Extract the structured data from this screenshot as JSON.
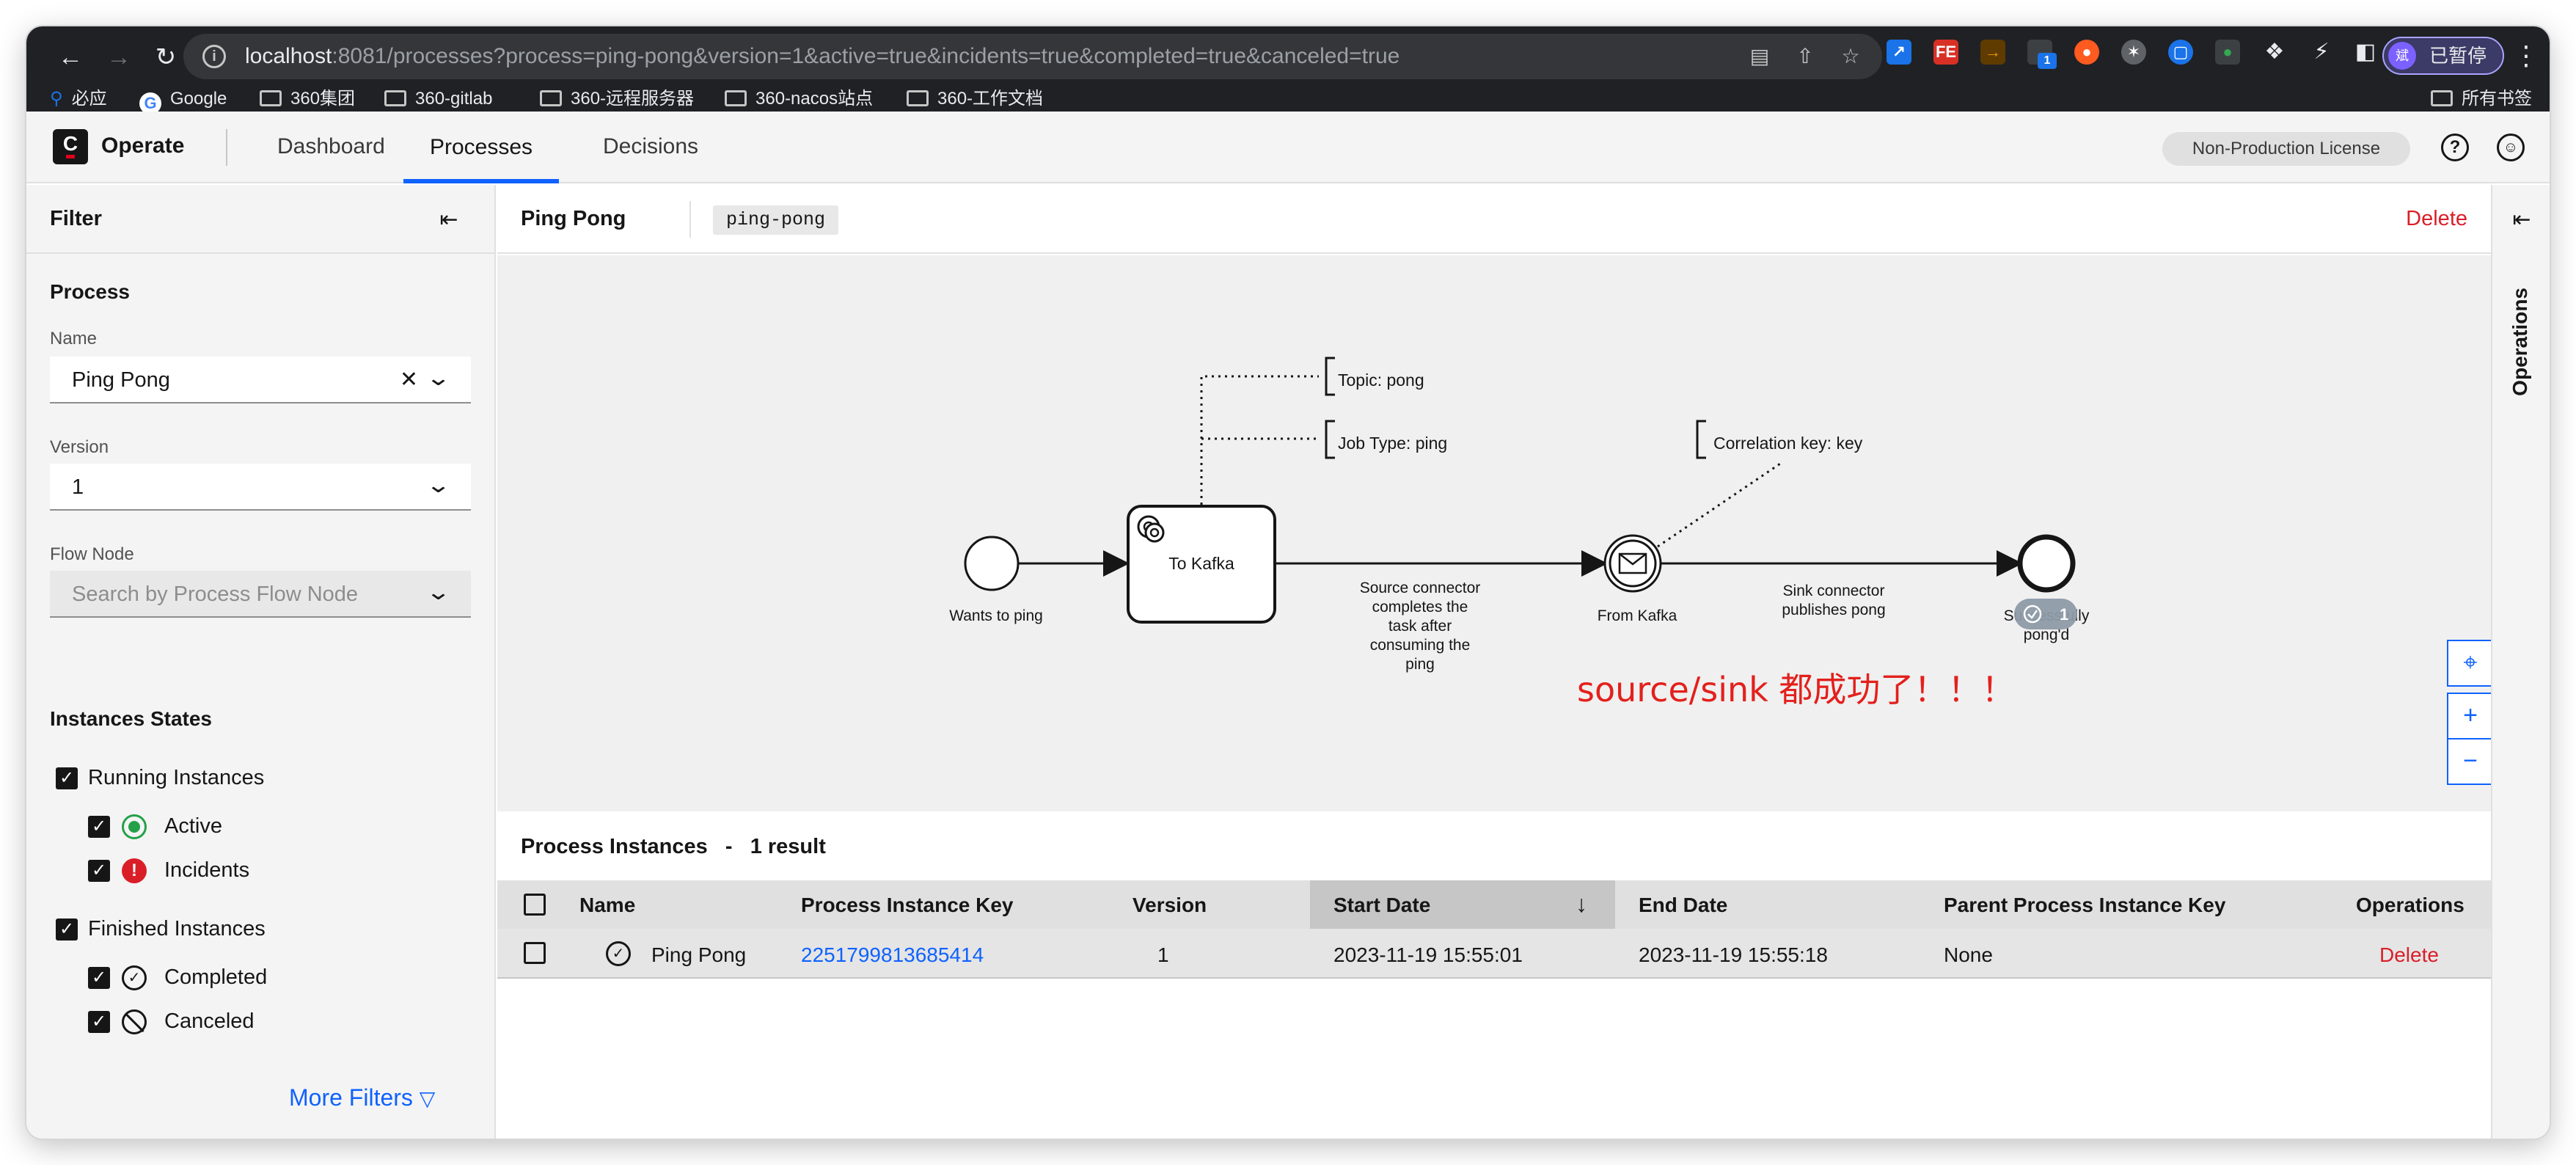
{
  "browser": {
    "url_host": "localhost",
    "url_rest": ":8081/processes?process=ping-pong&version=1&active=true&incidents=true&completed=true&canceled=true",
    "profile_label": "已暂停",
    "profile_initial": "斌",
    "ext_badge": "1",
    "bookmarks": [
      "必应",
      "Google",
      "360集团",
      "360-gitlab",
      "360-远程服务器",
      "360-nacos站点",
      "360-工作文档"
    ],
    "all_bookmarks": "所有书签"
  },
  "header": {
    "brand": "Operate",
    "logo": "C",
    "tabs": [
      "Dashboard",
      "Processes",
      "Decisions"
    ],
    "license": "Non-Production License"
  },
  "filters": {
    "title": "Filter",
    "process_section": "Process",
    "name_label": "Name",
    "name_value": "Ping Pong",
    "version_label": "Version",
    "version_value": "1",
    "flow_node_label": "Flow Node",
    "flow_node_placeholder": "Search by Process Flow Node",
    "states_section": "Instances States",
    "running": "Running Instances",
    "active": "Active",
    "incidents": "Incidents",
    "finished": "Finished Instances",
    "completed": "Completed",
    "canceled": "Canceled",
    "more_filters": "More Filters"
  },
  "process": {
    "name": "Ping Pong",
    "id": "ping-pong",
    "delete": "Delete"
  },
  "diagram": {
    "start_label": "Wants to ping",
    "task_label": "To Kafka",
    "topic_note": "Topic: pong",
    "jobtype_note": "Job Type: ping",
    "flow1_label": [
      "Source connector",
      "completes the",
      "task after",
      "consuming the",
      "ping"
    ],
    "catch_label": "From Kafka",
    "corr_note": "Correlation key: key",
    "flow2_label": [
      "Sink connector",
      "publishes pong"
    ],
    "end_label_1": "Successfully",
    "end_label_2": "pong'd",
    "completed_badge": "1",
    "annotation": "source/sink 都成功了！！！"
  },
  "instances": {
    "title": "Process Instances   -   1 result",
    "columns": [
      "Name",
      "Process Instance Key",
      "Version",
      "Start Date",
      "End Date",
      "Parent Process Instance Key",
      "Operations"
    ],
    "rows": [
      {
        "name": "Ping Pong",
        "key": "2251799813685414",
        "version": "1",
        "start": "2023-11-19 15:55:01",
        "end": "2023-11-19 15:55:18",
        "parent": "None",
        "op": "Delete"
      }
    ]
  },
  "operations_rail": {
    "label": "Operations"
  },
  "colors": {
    "accent": "#0f62fe",
    "danger": "#da1e28",
    "success": "#24a148",
    "annotation": "#e3201c"
  }
}
